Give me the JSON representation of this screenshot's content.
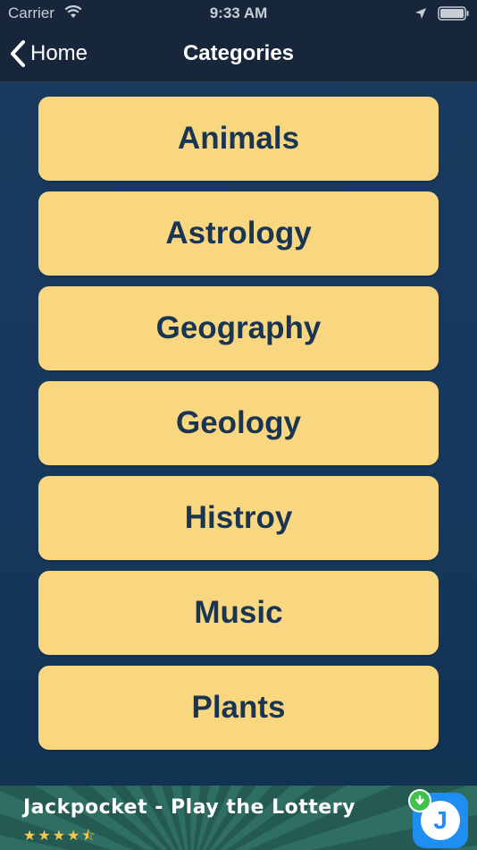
{
  "status_bar": {
    "carrier": "Carrier",
    "time": "9:33 AM"
  },
  "nav": {
    "back_label": "Home",
    "title": "Categories"
  },
  "categories": [
    "Animals",
    "Astrology",
    "Geography",
    "Geology",
    "Histroy",
    "Music",
    "Plants"
  ],
  "ad": {
    "title": "Jackpocket - Play the Lottery",
    "stars": "★★★★⯪",
    "icon_letter": "J"
  },
  "colors": {
    "accent_button": "#f9d680",
    "button_text": "#1a3552",
    "nav_bg": "#17263a",
    "page_bg": "#1a3a5e"
  }
}
